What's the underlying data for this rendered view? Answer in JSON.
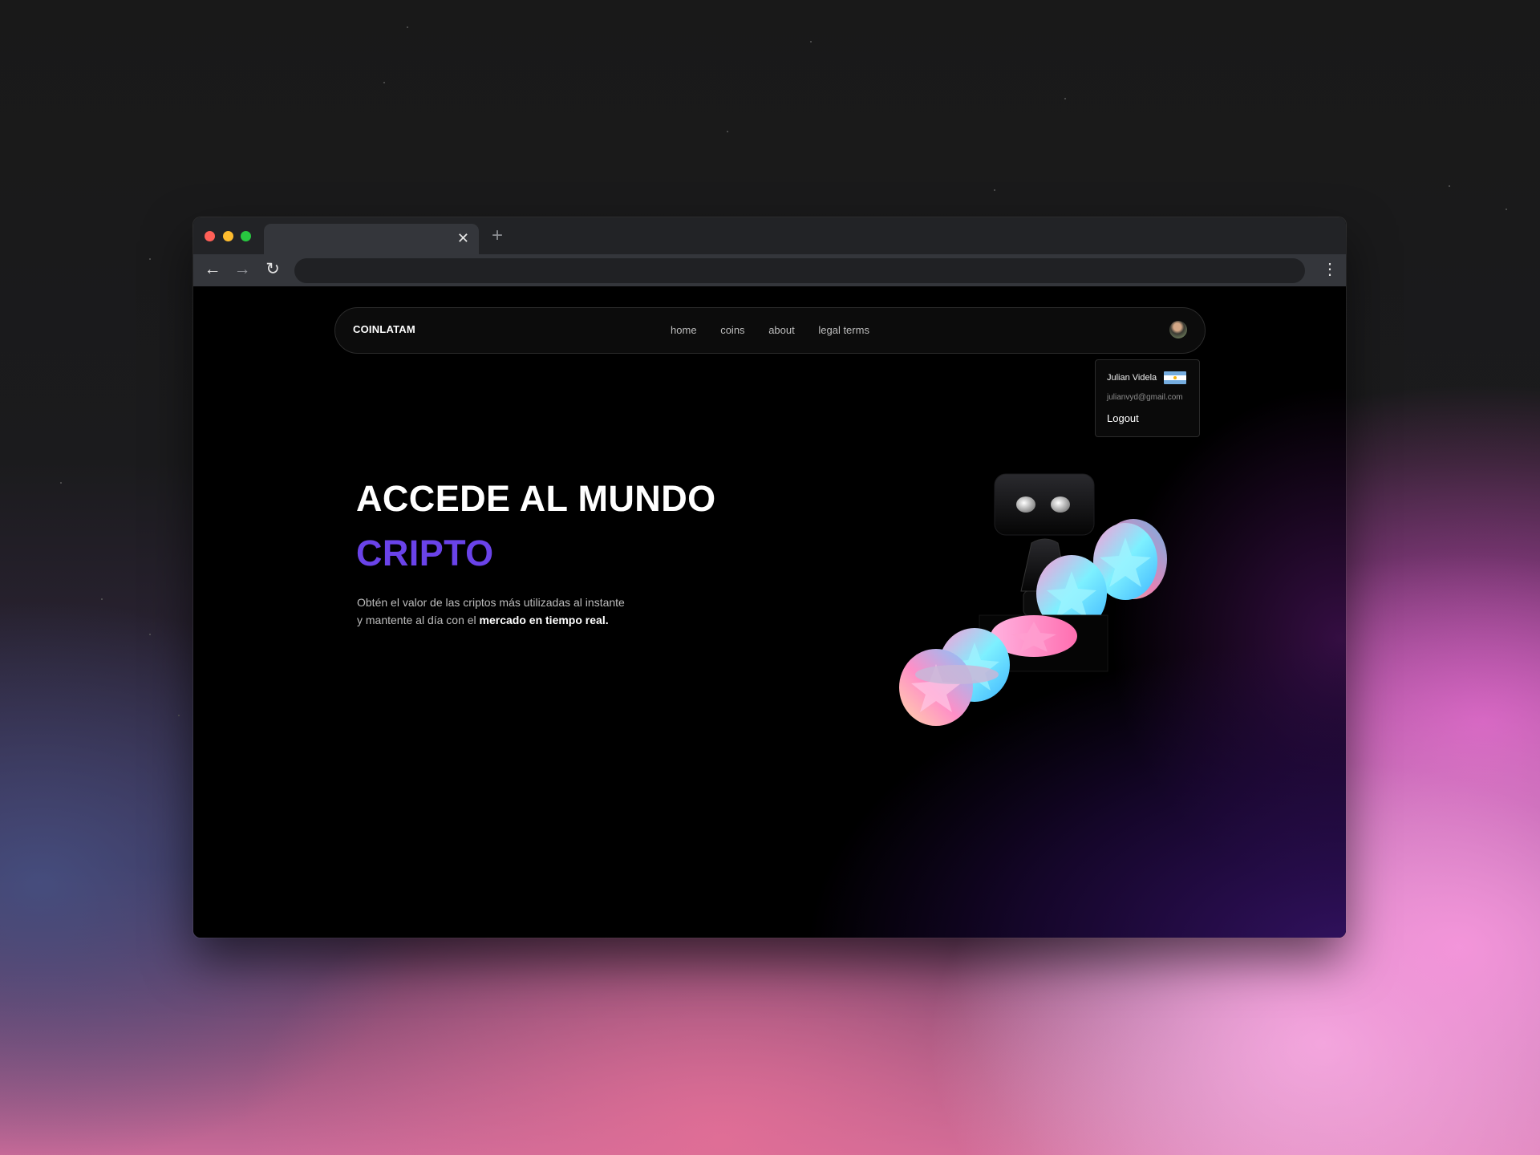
{
  "browser": {
    "tab_close_glyph": "✕",
    "new_tab_glyph": "+",
    "back_glyph": "←",
    "forward_glyph": "→",
    "reload_glyph": "↻",
    "menu_glyph": "⋮",
    "address": ""
  },
  "nav": {
    "brand": "COINLATAM",
    "links": [
      "home",
      "coins",
      "about",
      "legal terms"
    ]
  },
  "user_menu": {
    "name": "Julian Videla",
    "email": "julianvyd@gmail.com",
    "logout_label": "Logout",
    "flag_colors": [
      "#74acdf",
      "#ffffff",
      "#74acdf"
    ]
  },
  "hero": {
    "title_line1": "ACCEDE AL MUNDO",
    "title_line2": "CRIPTO",
    "description_plain": "Obtén el valor de las criptos más utilizadas al instante y mantente al día con el ",
    "description_bold": "mercado en tiempo real."
  },
  "colors": {
    "accent": "#6a43e9",
    "traffic_red": "#ff5f57",
    "traffic_yellow": "#febc2e",
    "traffic_green": "#28c840"
  },
  "icons": [
    "close-icon",
    "plus-icon",
    "back-arrow-icon",
    "forward-arrow-icon",
    "reload-icon",
    "more-vertical-icon",
    "avatar",
    "argentina-flag-icon"
  ]
}
